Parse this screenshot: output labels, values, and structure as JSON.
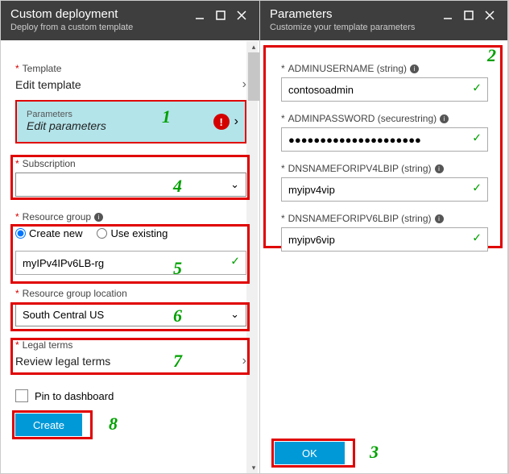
{
  "left": {
    "header": {
      "title": "Custom deployment",
      "subtitle": "Deploy from a custom template"
    },
    "template": {
      "asterisk": "*",
      "label": "Template",
      "value": "Edit template"
    },
    "parameters": {
      "label": "Parameters",
      "value": "Edit parameters"
    },
    "subscription": {
      "asterisk": "*",
      "label": "Subscription",
      "value": ""
    },
    "rg": {
      "asterisk": "*",
      "label": "Resource group",
      "create": "Create new",
      "use": "Use existing",
      "name": "myIPv4IPv6LB-rg"
    },
    "location": {
      "asterisk": "*",
      "label": "Resource group location",
      "value": "South Central US"
    },
    "legal": {
      "asterisk": "*",
      "label": "Legal terms",
      "value": "Review legal terms"
    },
    "pin": "Pin to dashboard",
    "create_btn": "Create"
  },
  "right": {
    "header": {
      "title": "Parameters",
      "subtitle": "Customize your template parameters"
    },
    "fields": [
      {
        "label": "ADMINUSERNAME (string)",
        "value": "contosoadmin"
      },
      {
        "label": "ADMINPASSWORD (securestring)",
        "value": "●●●●●●●●●●●●●●●●●●●●●"
      },
      {
        "label": "DNSNAMEFORIPV4LBIP (string)",
        "value": "myipv4vip"
      },
      {
        "label": "DNSNAMEFORIPV6LBIP (string)",
        "value": "myipv6vip"
      }
    ],
    "ok_btn": "OK"
  },
  "nums": {
    "n1": "1",
    "n2": "2",
    "n3": "3",
    "n4": "4",
    "n5": "5",
    "n6": "6",
    "n7": "7",
    "n8": "8"
  }
}
